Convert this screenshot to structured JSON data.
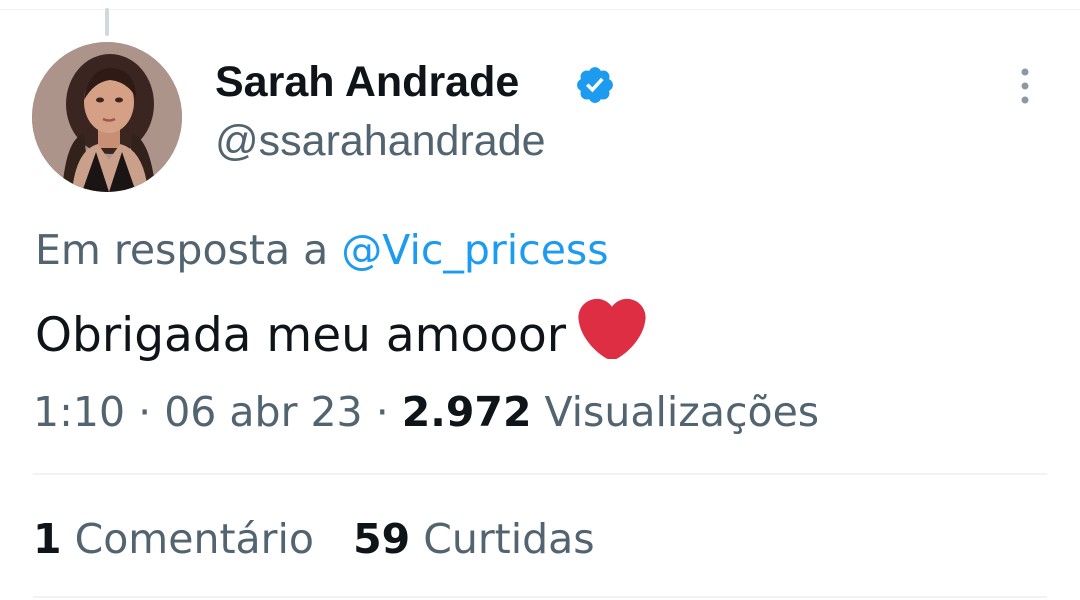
{
  "tweet": {
    "author": {
      "display_name": "Sarah Andrade",
      "handle": "@ssarahandrade",
      "verified": true,
      "avatar": "profile-photo"
    },
    "reply_prefix": "Em resposta a",
    "reply_to": "@Vic_pricess",
    "text": "Obrigada meu amooor",
    "emoji": "red-heart-icon",
    "time": "1:10",
    "separator": "·",
    "date": "06 abr 23",
    "views_count": "2.972",
    "views_label": "Visualizações",
    "stats": {
      "comments_count": "1",
      "comments_label": "Comentário",
      "likes_count": "59",
      "likes_label": "Curtidas"
    }
  },
  "colors": {
    "text_primary": "#0f1419",
    "text_secondary": "#536471",
    "accent": "#1d9bf0",
    "divider": "#eff3f4",
    "heart": "#dd2e44"
  }
}
